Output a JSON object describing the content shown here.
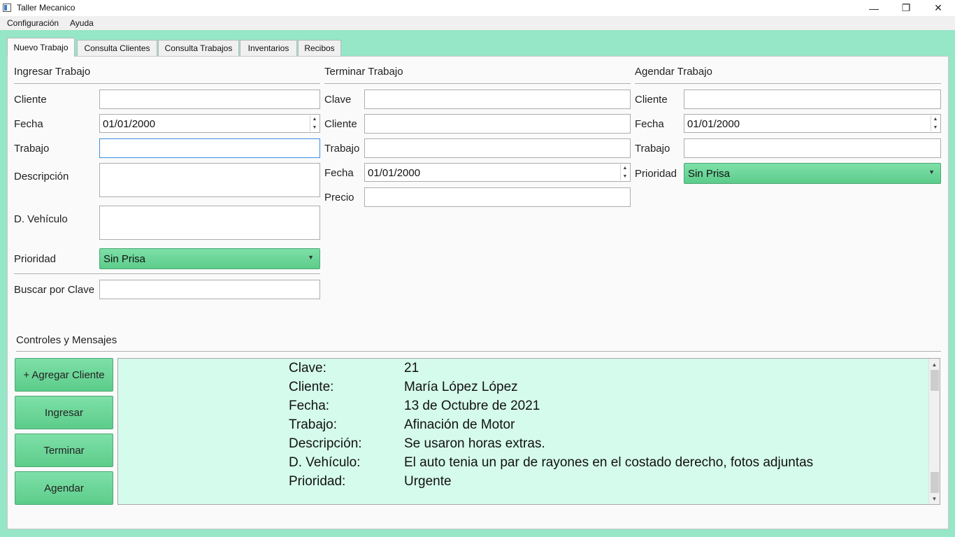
{
  "window": {
    "title": "Taller Mecanico",
    "minimize": "—",
    "restore": "❐",
    "close": "✕"
  },
  "menu": [
    "Configuración",
    "Ayuda"
  ],
  "tabs": [
    "Nuevo Trabajo",
    "Consulta Clientes",
    "Consulta Trabajos",
    "Inventarios",
    "Recibos"
  ],
  "ingresar": {
    "title": "Ingresar Trabajo",
    "cliente_label": "Cliente",
    "cliente_value": "",
    "fecha_label": "Fecha",
    "fecha_value": "01/01/2000",
    "trabajo_label": "Trabajo",
    "trabajo_value": "",
    "descripcion_label": "Descripción",
    "descripcion_value": "",
    "vehiculo_label": "D. Vehículo",
    "vehiculo_value": "",
    "prioridad_label": "Prioridad",
    "prioridad_value": "Sin Prisa",
    "buscar_label": "Buscar por Clave",
    "buscar_value": ""
  },
  "terminar": {
    "title": "Terminar Trabajo",
    "clave_label": "Clave",
    "clave_value": "",
    "cliente_label": "Cliente",
    "cliente_value": "",
    "trabajo_label": "Trabajo",
    "trabajo_value": "",
    "fecha_label": "Fecha",
    "fecha_value": "01/01/2000",
    "precio_label": "Precio",
    "precio_value": ""
  },
  "agendar": {
    "title": "Agendar Trabajo",
    "cliente_label": "Cliente",
    "cliente_value": "",
    "fecha_label": "Fecha",
    "fecha_value": "01/01/2000",
    "trabajo_label": "Trabajo",
    "trabajo_value": "",
    "prioridad_label": "Prioridad",
    "prioridad_value": "Sin Prisa"
  },
  "controles": {
    "title": "Controles y Mensajes",
    "buttons": [
      "+ Agregar Cliente",
      "Ingresar",
      "Terminar",
      "Agendar"
    ]
  },
  "mensaje": [
    {
      "key": "Clave:",
      "value": "21"
    },
    {
      "key": "Cliente:",
      "value": "María López López"
    },
    {
      "key": "Fecha:",
      "value": "13 de Octubre de 2021"
    },
    {
      "key": "Trabajo:",
      "value": "Afinación de Motor"
    },
    {
      "key": "Descripción:",
      "value": "Se usaron horas extras."
    },
    {
      "key": "D. Vehículo:",
      "value": "El auto tenia un par de rayones en el costado derecho, fotos adjuntas"
    },
    {
      "key": "Prioridad:",
      "value": "Urgente"
    }
  ],
  "colors": {
    "background": "#96e6c8",
    "button_green": "#6ad89a",
    "message_bg": "#d5fbec"
  }
}
